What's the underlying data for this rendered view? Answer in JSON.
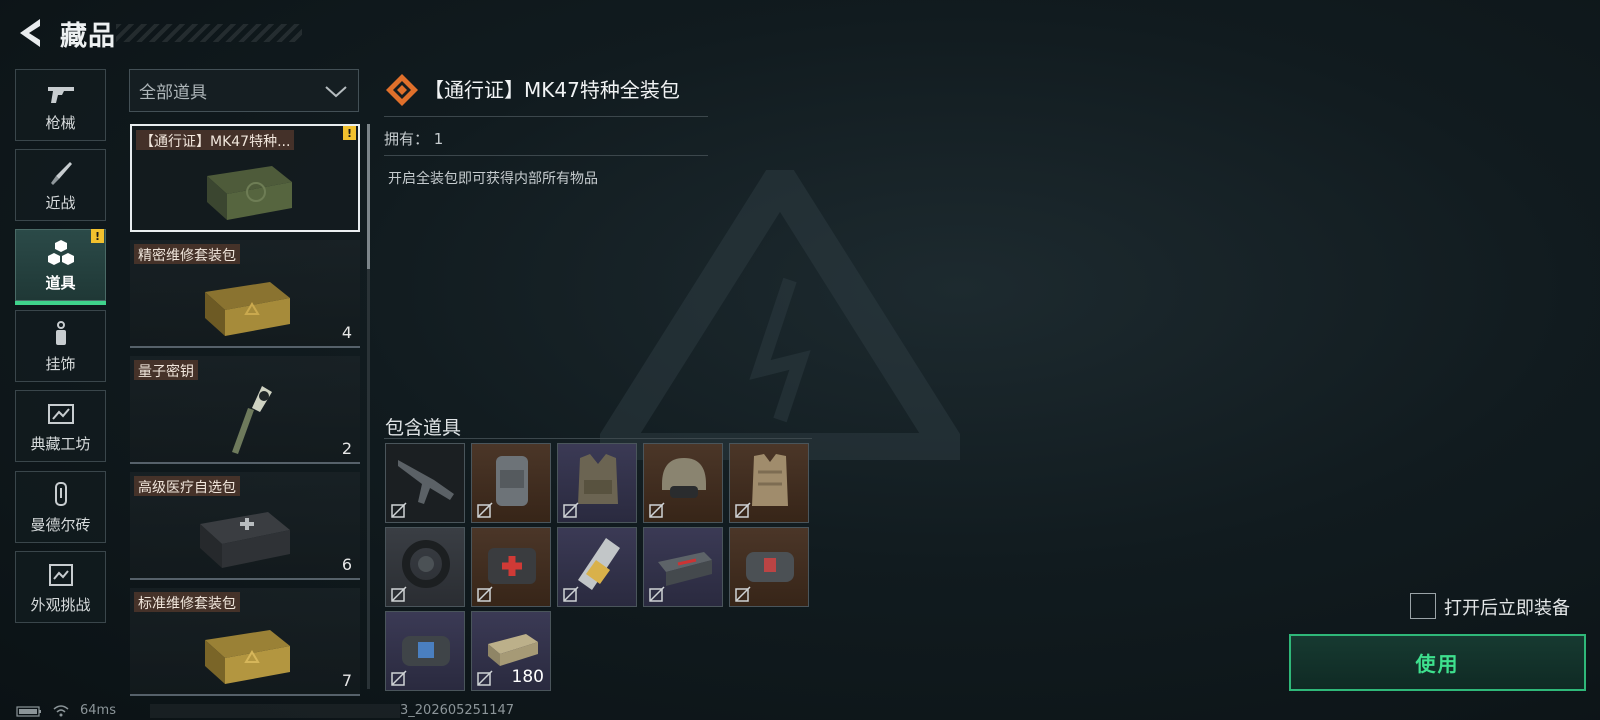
{
  "header": {
    "title": "藏品"
  },
  "sidebar": {
    "items": [
      {
        "label": "枪械",
        "icon": "gun-icon",
        "active": false,
        "alert": false
      },
      {
        "label": "近战",
        "icon": "knife-icon",
        "active": false,
        "alert": false
      },
      {
        "label": "道具",
        "icon": "cubes-icon",
        "active": true,
        "alert": true
      },
      {
        "label": "挂饰",
        "icon": "charm-icon",
        "active": false,
        "alert": false
      },
      {
        "label": "典藏工坊",
        "icon": "frame-icon",
        "active": false,
        "alert": false
      },
      {
        "label": "曼德尔砖",
        "icon": "brick-icon",
        "active": false,
        "alert": false
      },
      {
        "label": "外观挑战",
        "icon": "challenge-icon",
        "active": false,
        "alert": false
      }
    ],
    "alert_symbol": "!"
  },
  "filter": {
    "selected": "全部道具"
  },
  "item_list": [
    {
      "name": "【通行证】MK47特种...",
      "count": "",
      "selected": true,
      "alert": true
    },
    {
      "name": "精密维修套装包",
      "count": "4",
      "selected": false
    },
    {
      "name": "量子密钥",
      "count": "2",
      "selected": false
    },
    {
      "name": "高级医疗自选包",
      "count": "6",
      "selected": false
    },
    {
      "name": "标准维修套装包",
      "count": "7",
      "selected": false
    }
  ],
  "detail": {
    "title": "【通行证】MK47特种全装包",
    "owned_label": "拥有：",
    "owned_value": "1",
    "description": "开启全装包即可获得内部所有物品",
    "contents_label": "包含道具",
    "contents": [
      {
        "icon": "rifle-icon",
        "rarity": "dark",
        "qty": ""
      },
      {
        "icon": "backpack-icon",
        "rarity": "brown",
        "qty": ""
      },
      {
        "icon": "tactical-vest-icon",
        "rarity": "purple",
        "qty": ""
      },
      {
        "icon": "helmet-icon",
        "rarity": "brown",
        "qty": ""
      },
      {
        "icon": "armor-vest-icon",
        "rarity": "brown",
        "qty": ""
      },
      {
        "icon": "watch-icon",
        "rarity": "grey",
        "qty": ""
      },
      {
        "icon": "medkit-icon",
        "rarity": "brown",
        "qty": ""
      },
      {
        "icon": "injector-icon",
        "rarity": "purple",
        "qty": ""
      },
      {
        "icon": "repair-kit-icon",
        "rarity": "purple",
        "qty": ""
      },
      {
        "icon": "bag-icon",
        "rarity": "brown",
        "qty": ""
      },
      {
        "icon": "bag-icon",
        "rarity": "purple",
        "qty": ""
      },
      {
        "icon": "ammo-box-icon",
        "rarity": "purple",
        "qty": "180"
      }
    ]
  },
  "equip_option": {
    "label": "打开后立即装备",
    "checked": false
  },
  "actions": {
    "use_label": "使用"
  },
  "status": {
    "ping": "64ms",
    "build": "3_202605251147"
  },
  "colors": {
    "accent": "#3ee08e",
    "alert": "#f2c12e",
    "title_icon": "#e0702b"
  }
}
